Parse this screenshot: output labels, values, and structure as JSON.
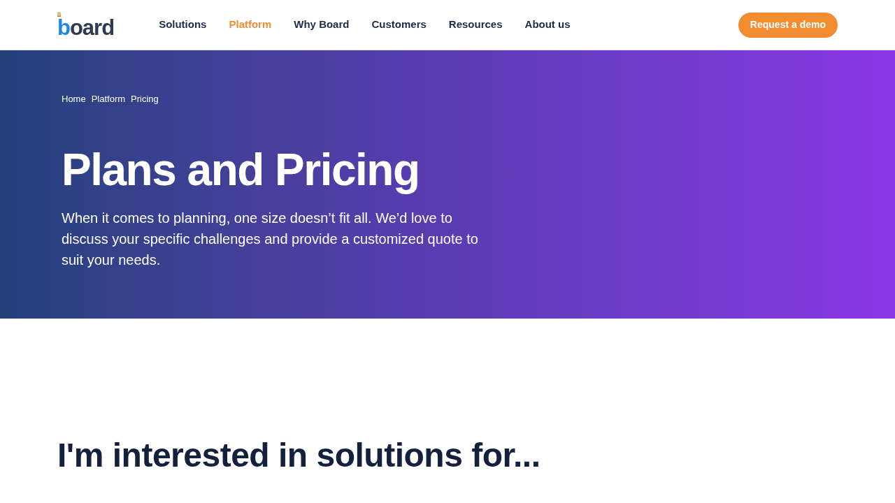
{
  "header": {
    "logo": "board",
    "nav": [
      {
        "label": "Solutions",
        "selected": false
      },
      {
        "label": "Platform",
        "selected": true
      },
      {
        "label": "Why Board",
        "selected": false
      },
      {
        "label": "Customers",
        "selected": false
      },
      {
        "label": "Resources",
        "selected": false
      },
      {
        "label": "About us",
        "selected": false
      }
    ],
    "cta": "Request a demo"
  },
  "hero": {
    "breadcrumb": [
      "Home",
      "Platform",
      "Pricing"
    ],
    "title": "Plans and Pricing",
    "description": "When it comes to planning, one size doesn’t fit all. We’d love to discuss your specific challenges and provide a customized quote to suit your needs."
  },
  "section": {
    "heading": "I'm interested in solutions for..."
  }
}
